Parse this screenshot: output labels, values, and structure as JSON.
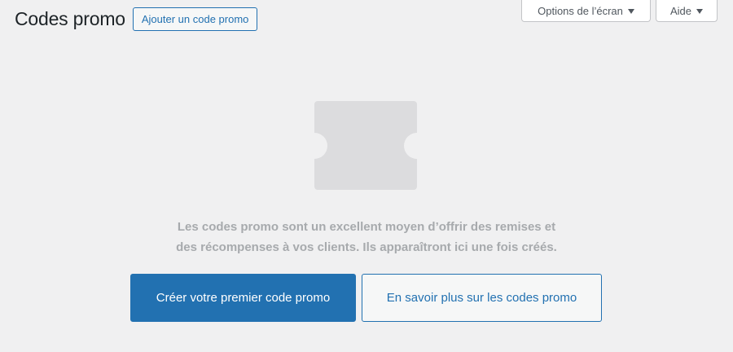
{
  "header": {
    "title": "Codes promo",
    "add_button_label": "Ajouter un code promo"
  },
  "screen_meta": {
    "options_label": "Options de l’écran",
    "help_label": "Aide"
  },
  "empty_state": {
    "icon": "coupon-ticket-icon",
    "message_line1": "Les codes promo sont un excellent moyen d’offrir des remises et",
    "message_line2": "des récompenses à vos clients. Ils apparaîtront ici une fois créés.",
    "primary_button_label": "Créer votre premier code promo",
    "secondary_button_label": "En savoir plus sur les codes promo"
  },
  "colors": {
    "background": "#f0f0f1",
    "accent": "#2271b1",
    "muted_text": "#a7aaad",
    "icon_fill": "#dcdcde"
  }
}
